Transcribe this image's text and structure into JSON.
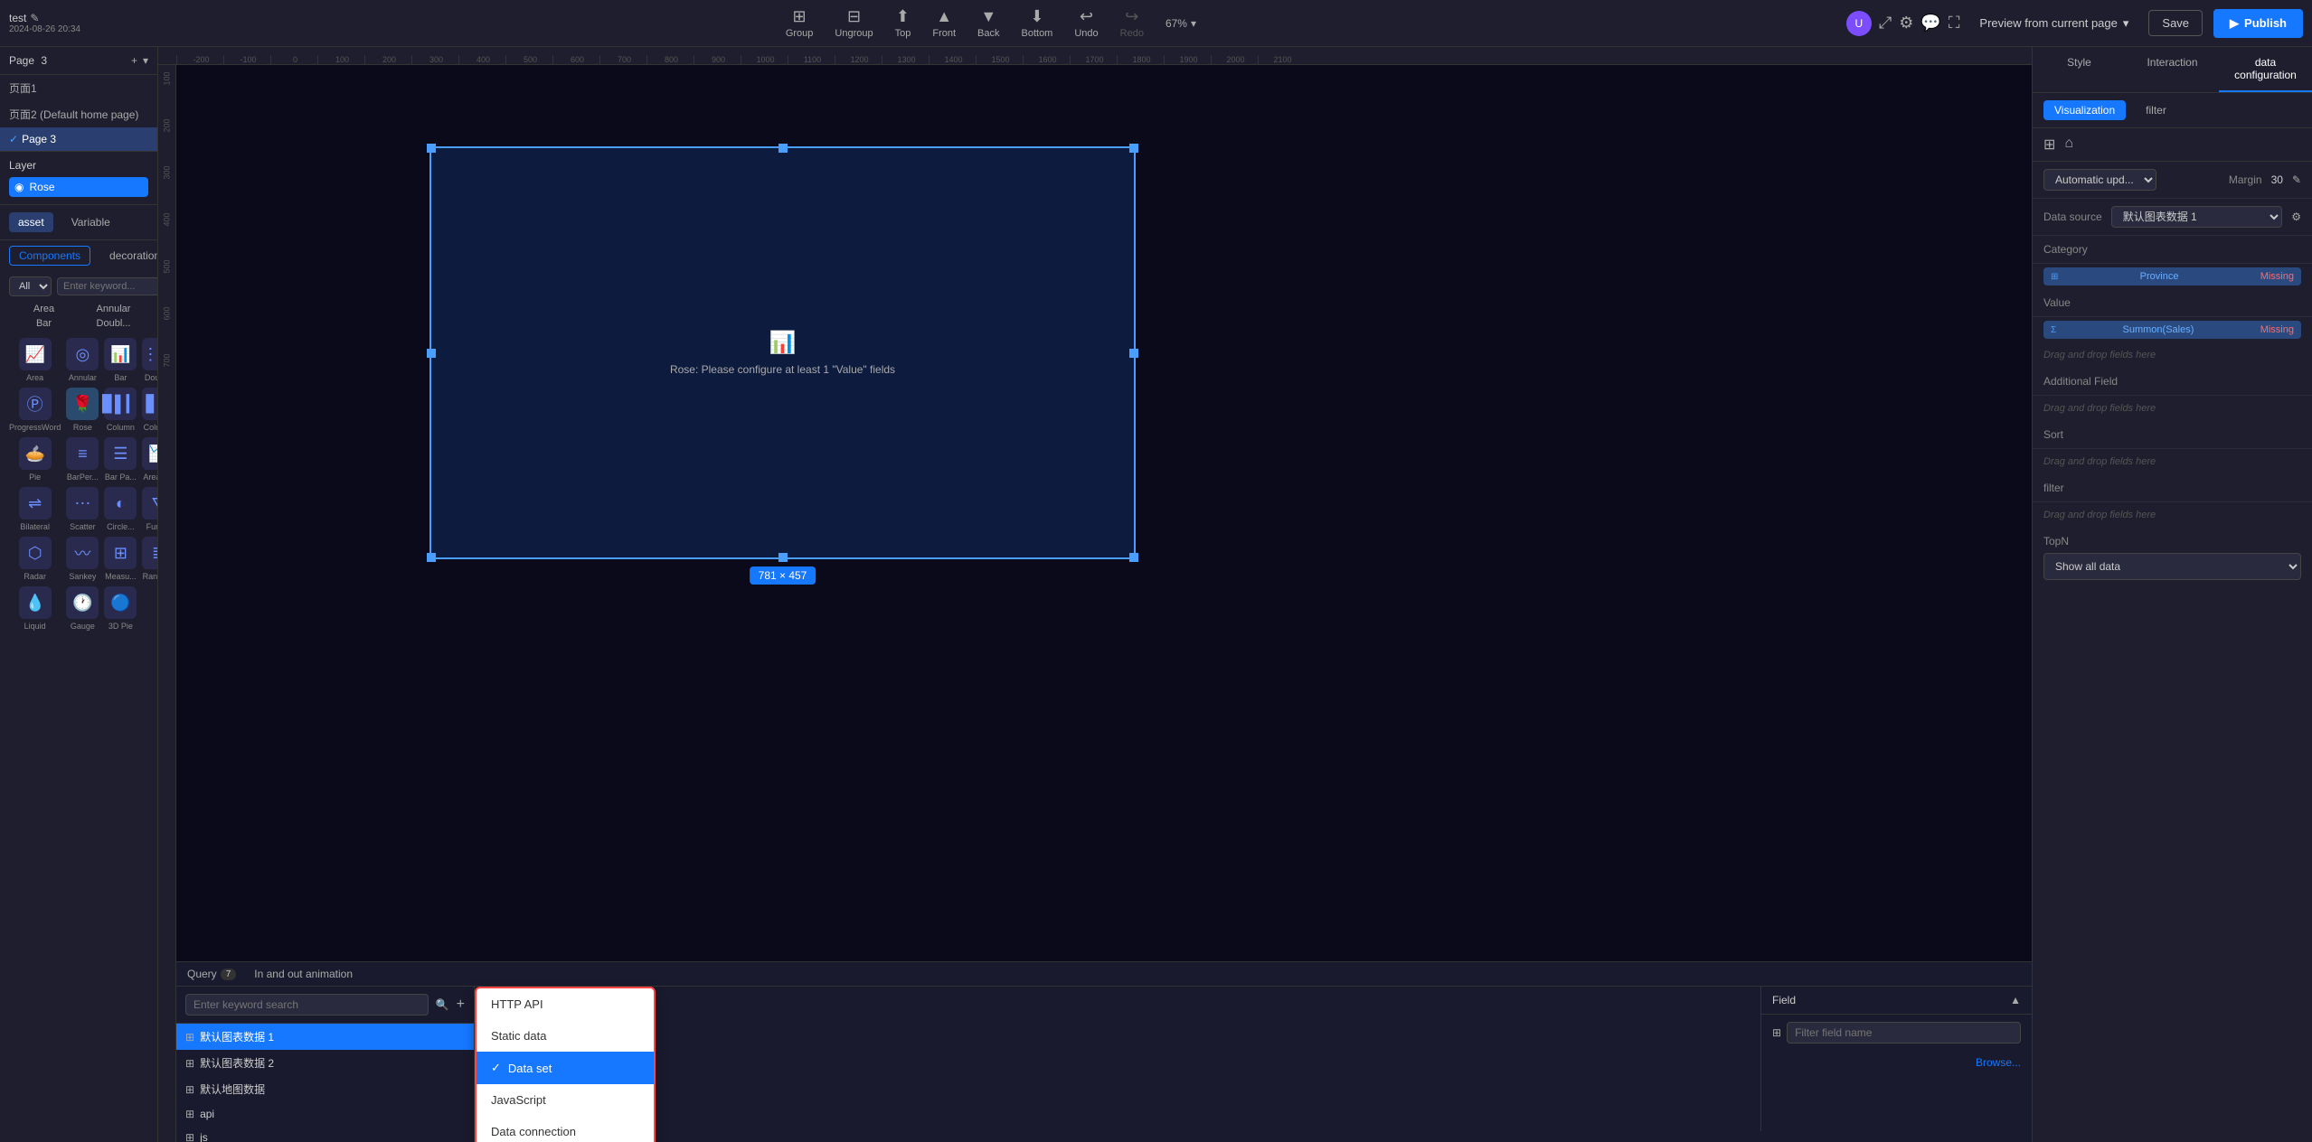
{
  "app": {
    "name": "test",
    "edit_icon": "✎",
    "date": "2024-08-26 20:34"
  },
  "toolbar": {
    "group_label": "Group",
    "ungroup_label": "Ungroup",
    "top_label": "Top",
    "front_label": "Front",
    "back_label": "Back",
    "bottom_label": "Bottom",
    "undo_label": "Undo",
    "redo_label": "Redo",
    "zoom_value": "67%",
    "preview_label": "Preview from current page",
    "save_label": "Save",
    "publish_label": "Publish"
  },
  "pages": {
    "label": "Page",
    "count": "3",
    "items": [
      {
        "name": "页面1",
        "active": false
      },
      {
        "name": "页面2 (Default home page)",
        "active": false
      },
      {
        "name": "Page 3",
        "active": true
      }
    ]
  },
  "layers": {
    "label": "Layer",
    "items": [
      {
        "name": "Rose",
        "active": true
      }
    ]
  },
  "asset_panel": {
    "tab_asset": "asset",
    "tab_variable": "Variable",
    "tab_components": "Components",
    "tab_decoration": "decoration",
    "filter_all": "All",
    "search_placeholder": "Enter keyword...",
    "chart_labels": [
      "Area",
      "Annular",
      "Bar",
      "Doubl...",
      "ProgressWord...",
      "Rose",
      "Column",
      "Colum...",
      "Pie",
      "BarPer...",
      "Bar Pa...",
      "Area P...",
      "Bilateral",
      "Scatter",
      "Circle...",
      "Funnel",
      "Radar",
      "Sankey",
      "Measu...",
      "Rankin...",
      "Liquid",
      "Gauge",
      "3D Pie"
    ]
  },
  "canvas": {
    "chart_message": "Rose: Please configure at least 1 \"Value\" fields",
    "size_badge": "781 × 457"
  },
  "ruler": {
    "h_marks": [
      "-200",
      "-100",
      "0",
      "100",
      "200",
      "300",
      "400",
      "500",
      "600",
      "700",
      "800",
      "900",
      "1000",
      "1100",
      "1200",
      "1300",
      "1400",
      "1500",
      "1600",
      "1700",
      "1800",
      "1900",
      "2000",
      "2100"
    ]
  },
  "bottom_panel": {
    "tabs": [
      {
        "label": "Query",
        "badge": "7"
      },
      {
        "label": "In and out animation",
        "badge": ""
      }
    ],
    "search_placeholder": "Enter keyword search",
    "data_sources": [
      {
        "name": "默认图表数据 1",
        "active": true
      },
      {
        "name": "默认图表数据 2",
        "active": false
      },
      {
        "name": "默认地图数据",
        "active": false
      },
      {
        "name": "api",
        "active": false
      },
      {
        "name": "js",
        "active": false
      }
    ],
    "field_label": "Field",
    "field_filter_placeholder": "Filter field name",
    "browse_label": "Browse..."
  },
  "dropdown": {
    "items": [
      {
        "label": "HTTP API",
        "active": false
      },
      {
        "label": "Static data",
        "active": false
      },
      {
        "label": "Data set",
        "active": true
      },
      {
        "label": "JavaScript",
        "active": false
      },
      {
        "label": "Data connection",
        "active": false
      }
    ]
  },
  "right_panel": {
    "tabs": [
      "Style",
      "Interaction",
      "data configuration"
    ],
    "active_tab": "data configuration",
    "viz_tabs": [
      "Visualization",
      "filter"
    ],
    "active_viz_tab": "Visualization",
    "auto_update_label": "Automatic upd...",
    "margin_label": "Margin",
    "margin_value": "30",
    "data_source_label": "Data source",
    "data_source_value": "默认图表数据 1",
    "category_label": "Category",
    "category_field": "Province",
    "category_missing": "Missing",
    "value_label": "Value",
    "value_field": "Summon(Sales)",
    "value_missing": "Missing",
    "additional_label": "Additional Field",
    "additional_drag": "Drag and drop fields here",
    "sort_label": "Sort",
    "sort_drag": "Drag and drop fields here",
    "filter_label": "filter",
    "filter_drag": "Drag and drop fields here",
    "topn_label": "TopN",
    "topn_value": "Show all data"
  }
}
